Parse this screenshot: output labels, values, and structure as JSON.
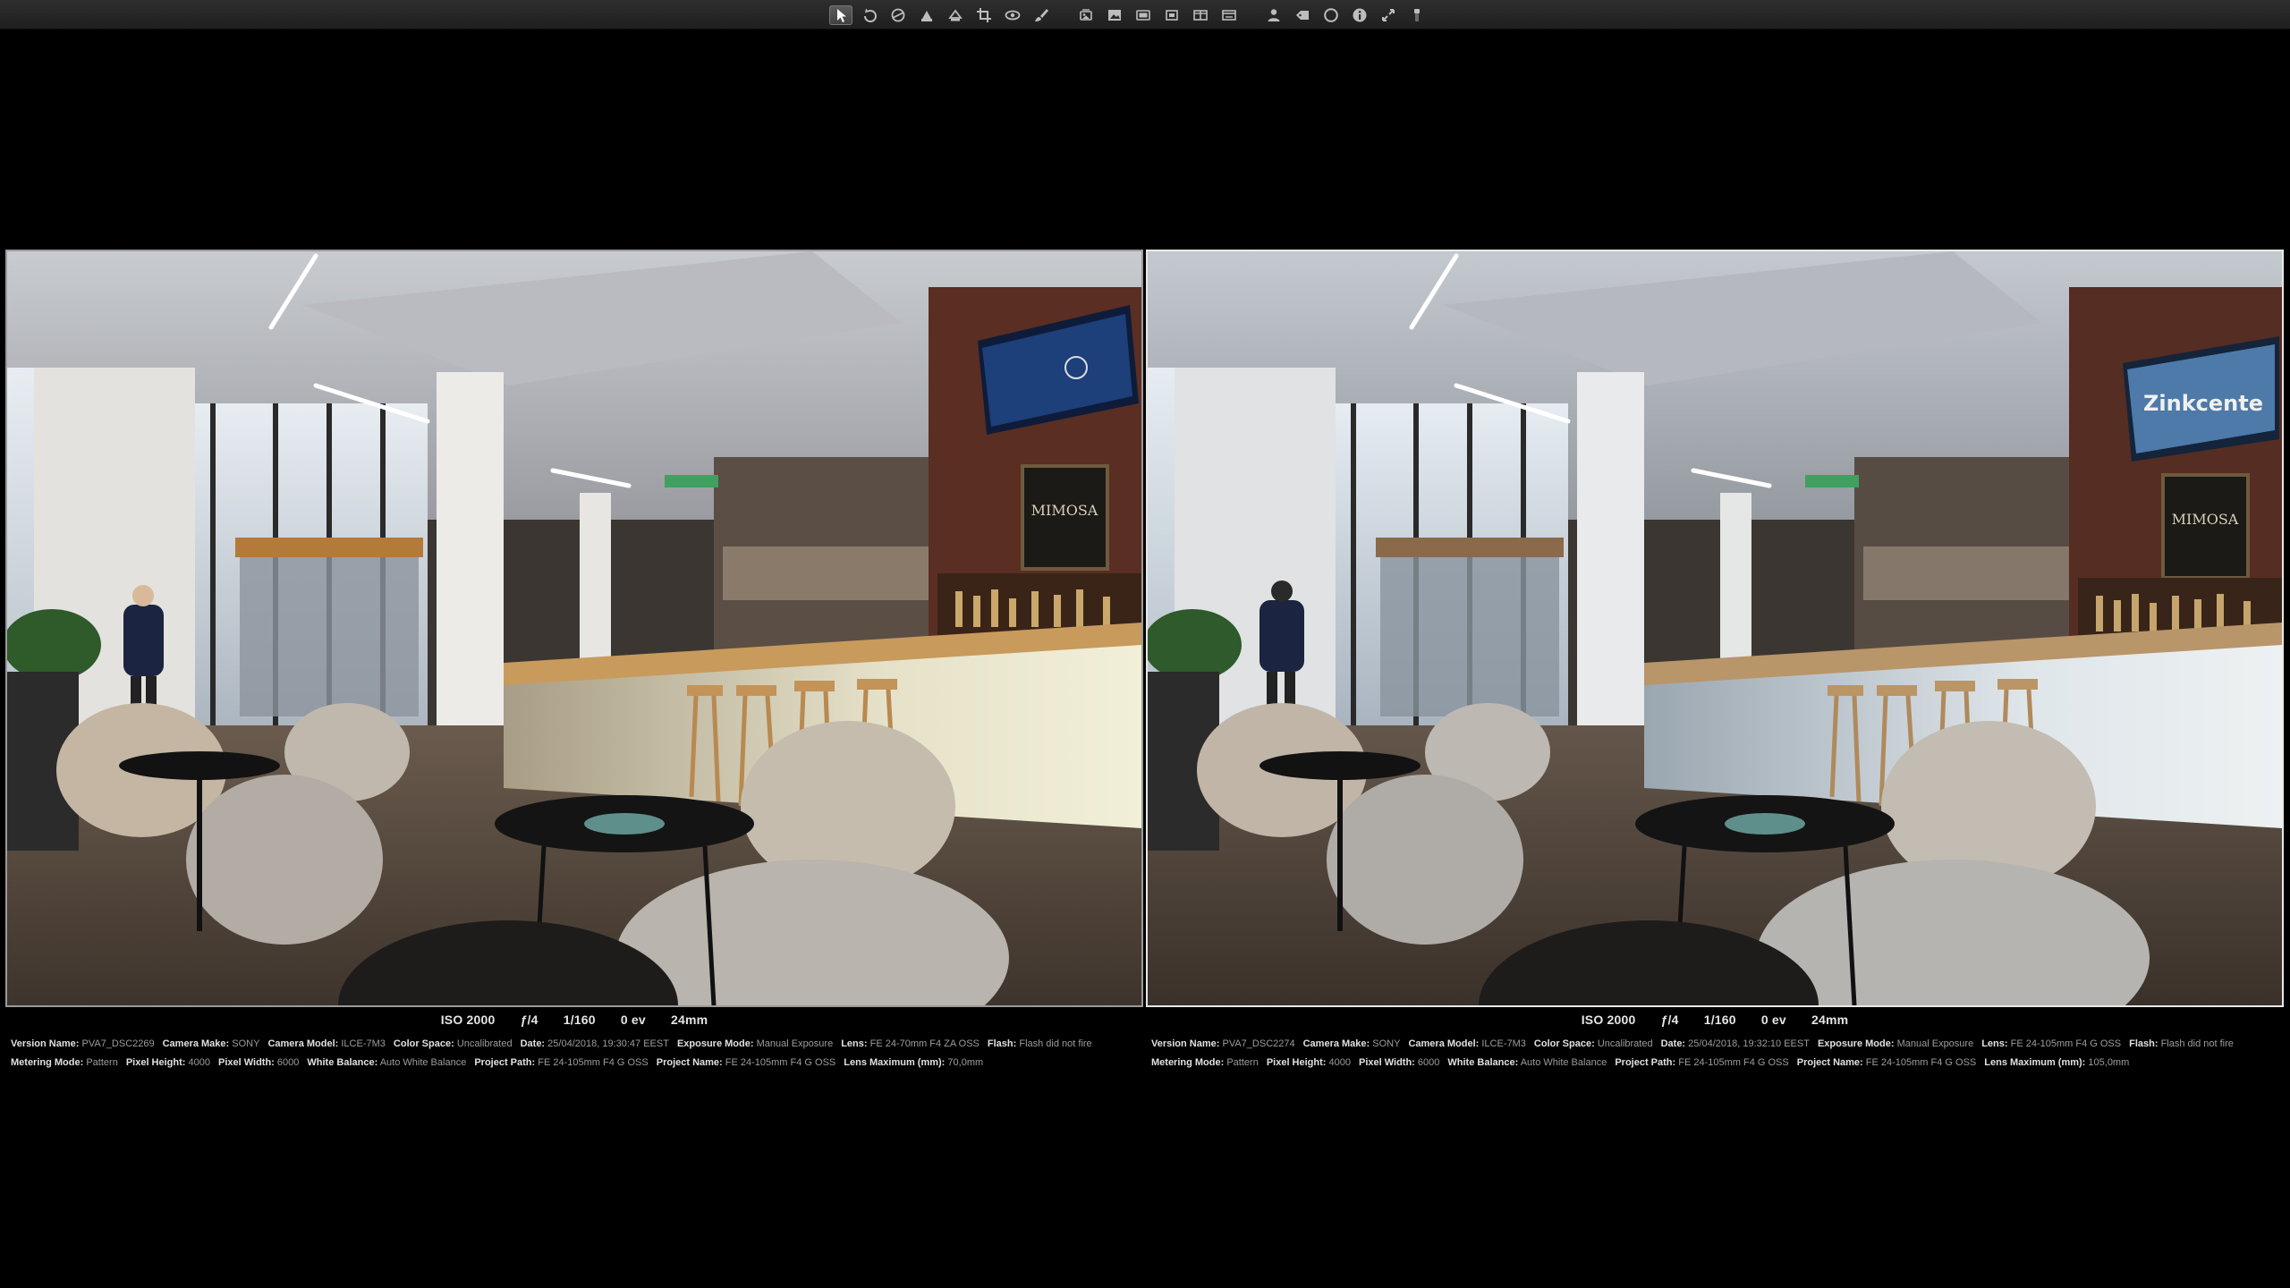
{
  "toolbar": {
    "tools": [
      {
        "icon": "pointer-icon",
        "active": true
      },
      {
        "icon": "rotate-icon"
      },
      {
        "icon": "straighten-icon"
      },
      {
        "icon": "lift-stamp-icon"
      },
      {
        "icon": "flip-icon"
      },
      {
        "icon": "crop-icon"
      },
      {
        "icon": "red-eye-icon"
      },
      {
        "icon": "brush-icon"
      },
      {
        "icon": "gap"
      },
      {
        "icon": "stack-icon"
      },
      {
        "icon": "viewer-mode-icon"
      },
      {
        "icon": "compare-icon"
      },
      {
        "icon": "loupe-mode-icon"
      },
      {
        "icon": "split-view-icon"
      },
      {
        "icon": "browser-mode-icon"
      },
      {
        "icon": "gap"
      },
      {
        "icon": "person-icon"
      },
      {
        "icon": "tag-icon"
      },
      {
        "icon": "loupe-icon"
      },
      {
        "icon": "info-icon"
      },
      {
        "icon": "full-screen-icon"
      },
      {
        "icon": "usb-icon"
      }
    ]
  },
  "panes": [
    {
      "exposure": {
        "iso": "ISO 2000",
        "aperture": "ƒ/4",
        "shutter": "1/160",
        "ev": "0 ev",
        "focal": "24mm"
      },
      "row1": [
        {
          "label": "Version Name:",
          "value": "PVA7_DSC2269"
        },
        {
          "label": "Camera Make:",
          "value": "SONY"
        },
        {
          "label": "Camera Model:",
          "value": "ILCE-7M3"
        },
        {
          "label": "Color Space:",
          "value": "Uncalibrated"
        },
        {
          "label": "Date:",
          "value": "25/04/2018, 19:30:47 EEST"
        },
        {
          "label": "Exposure Mode:",
          "value": "Manual Exposure"
        },
        {
          "label": "Lens:",
          "value": "FE 24-70mm F4 ZA OSS"
        },
        {
          "label": "Flash:",
          "value": "Flash did not fire"
        }
      ],
      "row2": [
        {
          "label": "Metering Mode:",
          "value": "Pattern"
        },
        {
          "label": "Pixel Height:",
          "value": "4000"
        },
        {
          "label": "Pixel Width:",
          "value": "6000"
        },
        {
          "label": "White Balance:",
          "value": "Auto White Balance"
        },
        {
          "label": "Project Path:",
          "value": "FE 24-105mm F4 G OSS"
        },
        {
          "label": "Project Name:",
          "value": "FE 24-105mm F4 G OSS"
        },
        {
          "label": "Lens Maximum (mm):",
          "value": "70,0mm"
        }
      ]
    },
    {
      "exposure": {
        "iso": "ISO 2000",
        "aperture": "ƒ/4",
        "shutter": "1/160",
        "ev": "0 ev",
        "focal": "24mm"
      },
      "row1": [
        {
          "label": "Version Name:",
          "value": "PVA7_DSC2274"
        },
        {
          "label": "Camera Make:",
          "value": "SONY"
        },
        {
          "label": "Camera Model:",
          "value": "ILCE-7M3"
        },
        {
          "label": "Color Space:",
          "value": "Uncalibrated"
        },
        {
          "label": "Date:",
          "value": "25/04/2018, 19:32:10 EEST"
        },
        {
          "label": "Exposure Mode:",
          "value": "Manual Exposure"
        },
        {
          "label": "Lens:",
          "value": "FE 24-105mm F4 G OSS"
        },
        {
          "label": "Flash:",
          "value": "Flash did not fire"
        }
      ],
      "row2": [
        {
          "label": "Metering Mode:",
          "value": "Pattern"
        },
        {
          "label": "Pixel Height:",
          "value": "4000"
        },
        {
          "label": "Pixel Width:",
          "value": "6000"
        },
        {
          "label": "White Balance:",
          "value": "Auto White Balance"
        },
        {
          "label": "Project Path:",
          "value": "FE 24-105mm F4 G OSS"
        },
        {
          "label": "Project Name:",
          "value": "FE 24-105mm F4 G OSS"
        },
        {
          "label": "Lens Maximum (mm):",
          "value": "105,0mm"
        }
      ]
    }
  ]
}
